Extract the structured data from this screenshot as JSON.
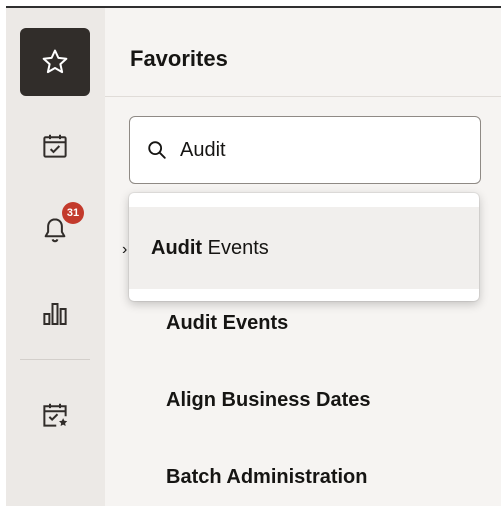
{
  "rail": {
    "items": [
      {
        "name": "favorites",
        "icon": "star-icon",
        "active": true
      },
      {
        "name": "tasks",
        "icon": "calendar-check-icon"
      },
      {
        "name": "notifications",
        "icon": "bell-icon",
        "badge": "31"
      },
      {
        "name": "reports",
        "icon": "bar-chart-icon"
      },
      {
        "name": "favorite-tasks",
        "icon": "calendar-star-icon"
      }
    ]
  },
  "panel": {
    "title": "Favorites",
    "search": {
      "value": "Audit",
      "placeholder": ""
    },
    "suggestion": {
      "match": "Audit",
      "rest": " Events"
    },
    "favorites": [
      "Audit Events",
      "Align Business Dates",
      "Batch Administration"
    ]
  },
  "colors": {
    "active_rail": "#312d2a",
    "badge": "#c33a2c",
    "rail_bg": "#ece9e6",
    "panel_bg": "#f6f4f2"
  }
}
